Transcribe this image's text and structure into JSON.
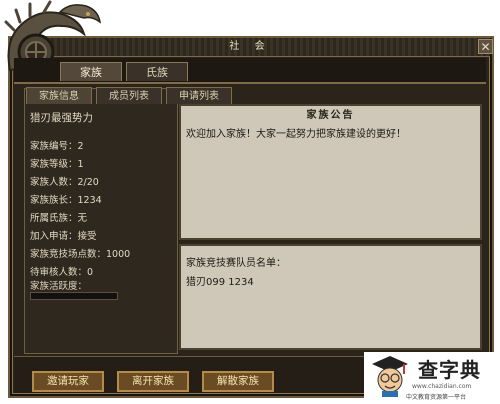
{
  "window": {
    "title": "社 会",
    "close_label": "✕"
  },
  "main_tabs": [
    {
      "label": "家族",
      "active": true
    },
    {
      "label": "氏族",
      "active": false
    }
  ],
  "sub_tabs": [
    {
      "label": "家族信息",
      "active": true
    },
    {
      "label": "成员列表",
      "active": false
    },
    {
      "label": "申请列表",
      "active": false
    }
  ],
  "family": {
    "name": "猎刃最强势力",
    "id_line": "家族编号：2",
    "level_line": "家族等级：1",
    "members_line": "家族人数：2/20",
    "leader_line": "家族族长：1234",
    "clan_line": "所属氏族：无",
    "join_line": "加入申请：接受",
    "arena_line": "家族竞技场点数：1000",
    "pending_line": "待审核人数：0",
    "activity_line": "家族活跃度：",
    "activity_value": 0
  },
  "notice": {
    "title": "家族公告",
    "text": "欢迎加入家族！大家一起努力把家族建设的更好！"
  },
  "roster": {
    "title": "家族竞技赛队员名单：",
    "entry": "猎刃099 1234"
  },
  "buttons": {
    "invite": "邀请玩家",
    "leave": "离开家族",
    "disband": "解散家族"
  },
  "watermark": {
    "title": "查字典",
    "url": "www.chazidian.com",
    "sub": "中文教育资源第一平台"
  },
  "colors": {
    "panel_bg": "#2b241a",
    "text_light": "#e2d8c0",
    "notice_bg": "#cfc8b8",
    "button_bg": "#6a4c24",
    "button_border": "#b48c48"
  }
}
